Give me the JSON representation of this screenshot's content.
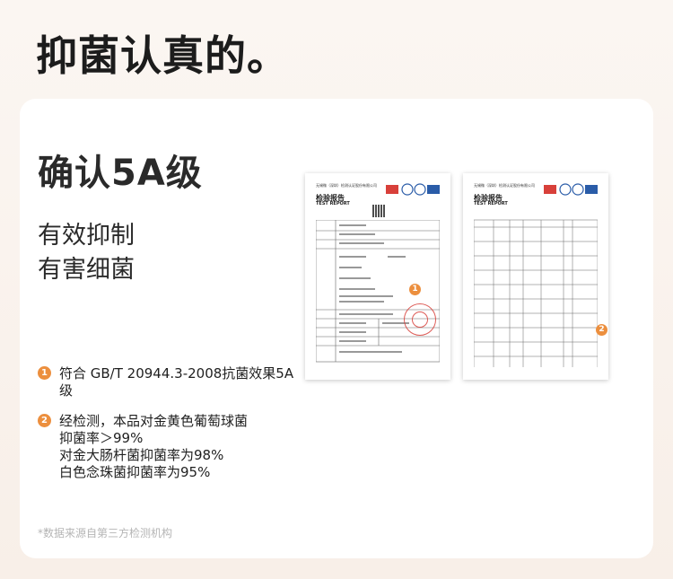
{
  "headline": "抑菌认真的。",
  "card": {
    "title": "确认5A级",
    "subtitle_line1": "有效抑制",
    "subtitle_line2": "有害细菌",
    "points": [
      {
        "num": "1",
        "text": "符合 GB/T 20944.3-2008抗菌效果5A级"
      },
      {
        "num": "2",
        "text_lines": [
          "经检测，本品对金黄色葡萄球菌",
          "抑菌率＞99%",
          "对金大肠杆菌抑菌率为98%",
          "白色念珠菌抑菌率为95%"
        ]
      }
    ],
    "footnote": "*数据来源自第三方检测机构"
  },
  "reports": [
    {
      "org": "无锡微（深圳）检测认证股份有限公司",
      "title_cn": "检验报告",
      "title_en": "TEST REPORT",
      "marker": "1"
    },
    {
      "org": "无锡微（深圳）检测认证股份有限公司",
      "title_cn": "检验报告",
      "title_en": "TEST REPORT",
      "marker": "2"
    }
  ],
  "colors": {
    "accent": "#ec8f3e",
    "stamp": "#d8403a",
    "card": "#ffffff",
    "background": "#fbf6f2"
  }
}
